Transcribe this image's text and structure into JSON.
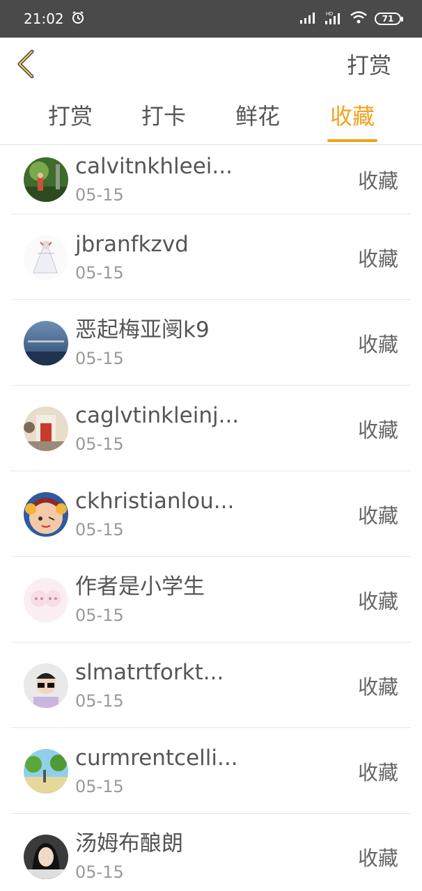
{
  "status_bar": {
    "time": "21:02",
    "battery": "71"
  },
  "header": {
    "action_label": "打赏"
  },
  "tabs": [
    {
      "label": "打赏",
      "active": false
    },
    {
      "label": "打卡",
      "active": false
    },
    {
      "label": "鲜花",
      "active": false
    },
    {
      "label": "收藏",
      "active": true
    }
  ],
  "list": [
    {
      "name": "calvitnkhleei...",
      "date": "05-15",
      "action": "收藏"
    },
    {
      "name": "jbranfkzvd",
      "date": "05-15",
      "action": "收藏"
    },
    {
      "name": "恶起梅亚阌k9",
      "date": "05-15",
      "action": "收藏"
    },
    {
      "name": "caglvtinkleinj...",
      "date": "05-15",
      "action": "收藏"
    },
    {
      "name": "ckhristianlou...",
      "date": "05-15",
      "action": "收藏"
    },
    {
      "name": "作者是小学生",
      "date": "05-15",
      "action": "收藏"
    },
    {
      "name": "slmatrtforkt...",
      "date": "05-15",
      "action": "收藏"
    },
    {
      "name": "curmrentcelli...",
      "date": "05-15",
      "action": "收藏"
    },
    {
      "name": "汤姆布酿朗",
      "date": "05-15",
      "action": "收藏"
    }
  ],
  "colors": {
    "accent": "#f2a21c",
    "statusbar": "#4a4a4a"
  }
}
